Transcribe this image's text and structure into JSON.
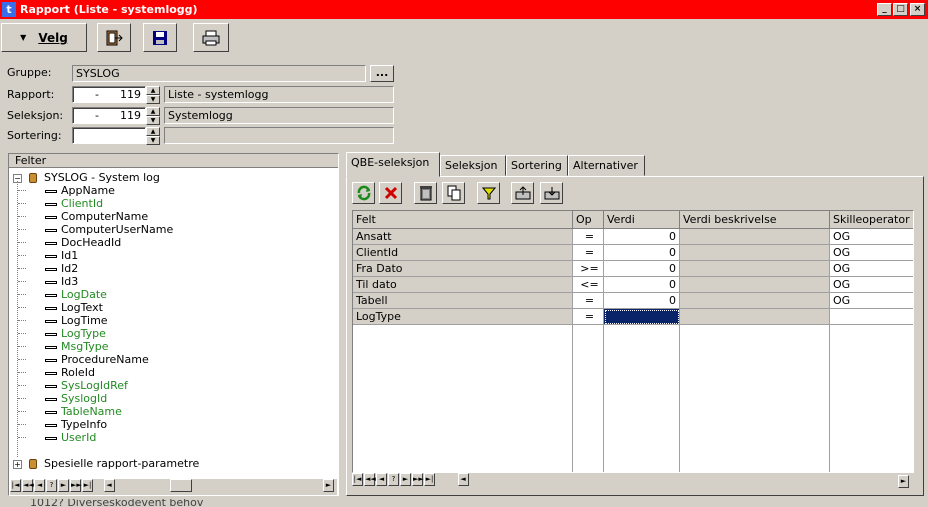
{
  "window": {
    "title": "Rapport (Liste - systemlogg)",
    "app_icon": "t",
    "minimize": "_",
    "maximize": "□",
    "close": "×"
  },
  "toolbar": {
    "velg_label": "Velg"
  },
  "form": {
    "gruppe_label": "Gruppe:",
    "gruppe_value": "SYSLOG",
    "gruppe_browse": "...",
    "rapport_label": "Rapport:",
    "rapport_dash": "-",
    "rapport_num": "119",
    "rapport_desc": "Liste - systemlogg",
    "seleksjon_label": "Seleksjon:",
    "seleksjon_dash": "-",
    "seleksjon_num": "119",
    "seleksjon_desc": "Systemlogg",
    "sortering_label": "Sortering:"
  },
  "tree": {
    "header": "Felter",
    "root": "SYSLOG - System log",
    "items": [
      {
        "label": "AppName",
        "color": "black"
      },
      {
        "label": "ClientId",
        "color": "green"
      },
      {
        "label": "ComputerName",
        "color": "black"
      },
      {
        "label": "ComputerUserName",
        "color": "black"
      },
      {
        "label": "DocHeadId",
        "color": "black"
      },
      {
        "label": "Id1",
        "color": "black"
      },
      {
        "label": "Id2",
        "color": "black"
      },
      {
        "label": "Id3",
        "color": "black"
      },
      {
        "label": "LogDate",
        "color": "green"
      },
      {
        "label": "LogText",
        "color": "black"
      },
      {
        "label": "LogTime",
        "color": "black"
      },
      {
        "label": "LogType",
        "color": "green"
      },
      {
        "label": "MsgType",
        "color": "green"
      },
      {
        "label": "ProcedureName",
        "color": "black"
      },
      {
        "label": "RoleId",
        "color": "black"
      },
      {
        "label": "SysLogIdRef",
        "color": "green"
      },
      {
        "label": "SyslogId",
        "color": "green"
      },
      {
        "label": "TableName",
        "color": "green"
      },
      {
        "label": "TypeInfo",
        "color": "black"
      },
      {
        "label": "UserId",
        "color": "green"
      }
    ],
    "second_root": "Spesielle rapport-parametre"
  },
  "tabs": [
    "QBE-seleksjon",
    "Seleksjon",
    "Sortering",
    "Alternativer"
  ],
  "grid": {
    "columns": [
      "Felt",
      "Op",
      "Verdi",
      "Verdi beskrivelse",
      "Skilleoperator"
    ],
    "rows": [
      {
        "felt": "Ansatt",
        "op": "=",
        "verdi": "0",
        "beskrivelse": "",
        "skille": "OG"
      },
      {
        "felt": "ClientId",
        "op": "=",
        "verdi": "0",
        "beskrivelse": "",
        "skille": "OG"
      },
      {
        "felt": "Fra Dato",
        "op": ">=",
        "verdi": "0",
        "beskrivelse": "",
        "skille": "OG"
      },
      {
        "felt": "Til dato",
        "op": "<=",
        "verdi": "0",
        "beskrivelse": "",
        "skille": "OG"
      },
      {
        "felt": "Tabell",
        "op": "=",
        "verdi": "0",
        "beskrivelse": "",
        "skille": "OG"
      },
      {
        "felt": "LogType",
        "op": "=",
        "verdi": "",
        "beskrivelse": "",
        "skille": ""
      }
    ]
  },
  "nav": {
    "first": "|◄",
    "prev_page": "◄◄",
    "prev": "◄",
    "help": "?",
    "next": "►",
    "next_page": "►►",
    "last": "►|"
  },
  "bottom_cut_text": "1012? Diverseskodevent behov",
  "colors": {
    "titlebar": "#ff0000",
    "selected_cell": "#0a246a",
    "green_field": "#238923"
  }
}
